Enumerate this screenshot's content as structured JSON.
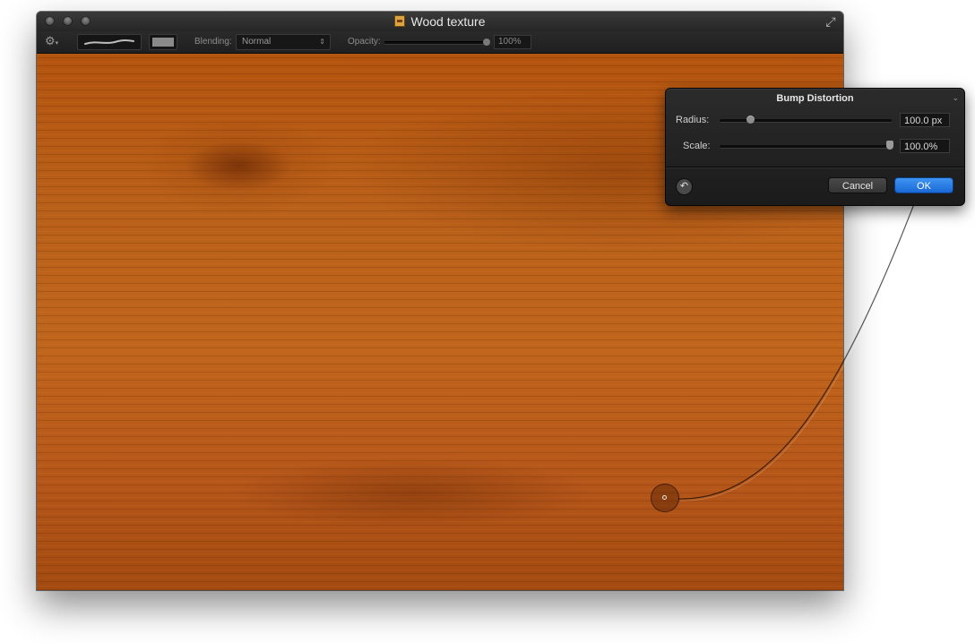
{
  "window": {
    "title": "Wood texture",
    "doc_icon": "image-document-icon"
  },
  "toolbar": {
    "blending_label": "Blending:",
    "blending_value": "Normal",
    "opacity_label": "Opacity:",
    "opacity_value": "100%",
    "opacity_fraction": 1.0
  },
  "panel": {
    "title": "Bump Distortion",
    "radius_label": "Radius:",
    "radius_value": "100.0 px",
    "scale_label": "Scale:",
    "scale_value": "100.0%",
    "scale_fraction": 1.0,
    "cancel_label": "Cancel",
    "ok_label": "OK"
  },
  "colors": {
    "accent": "#1f73e0",
    "wood": "#b95e18"
  }
}
